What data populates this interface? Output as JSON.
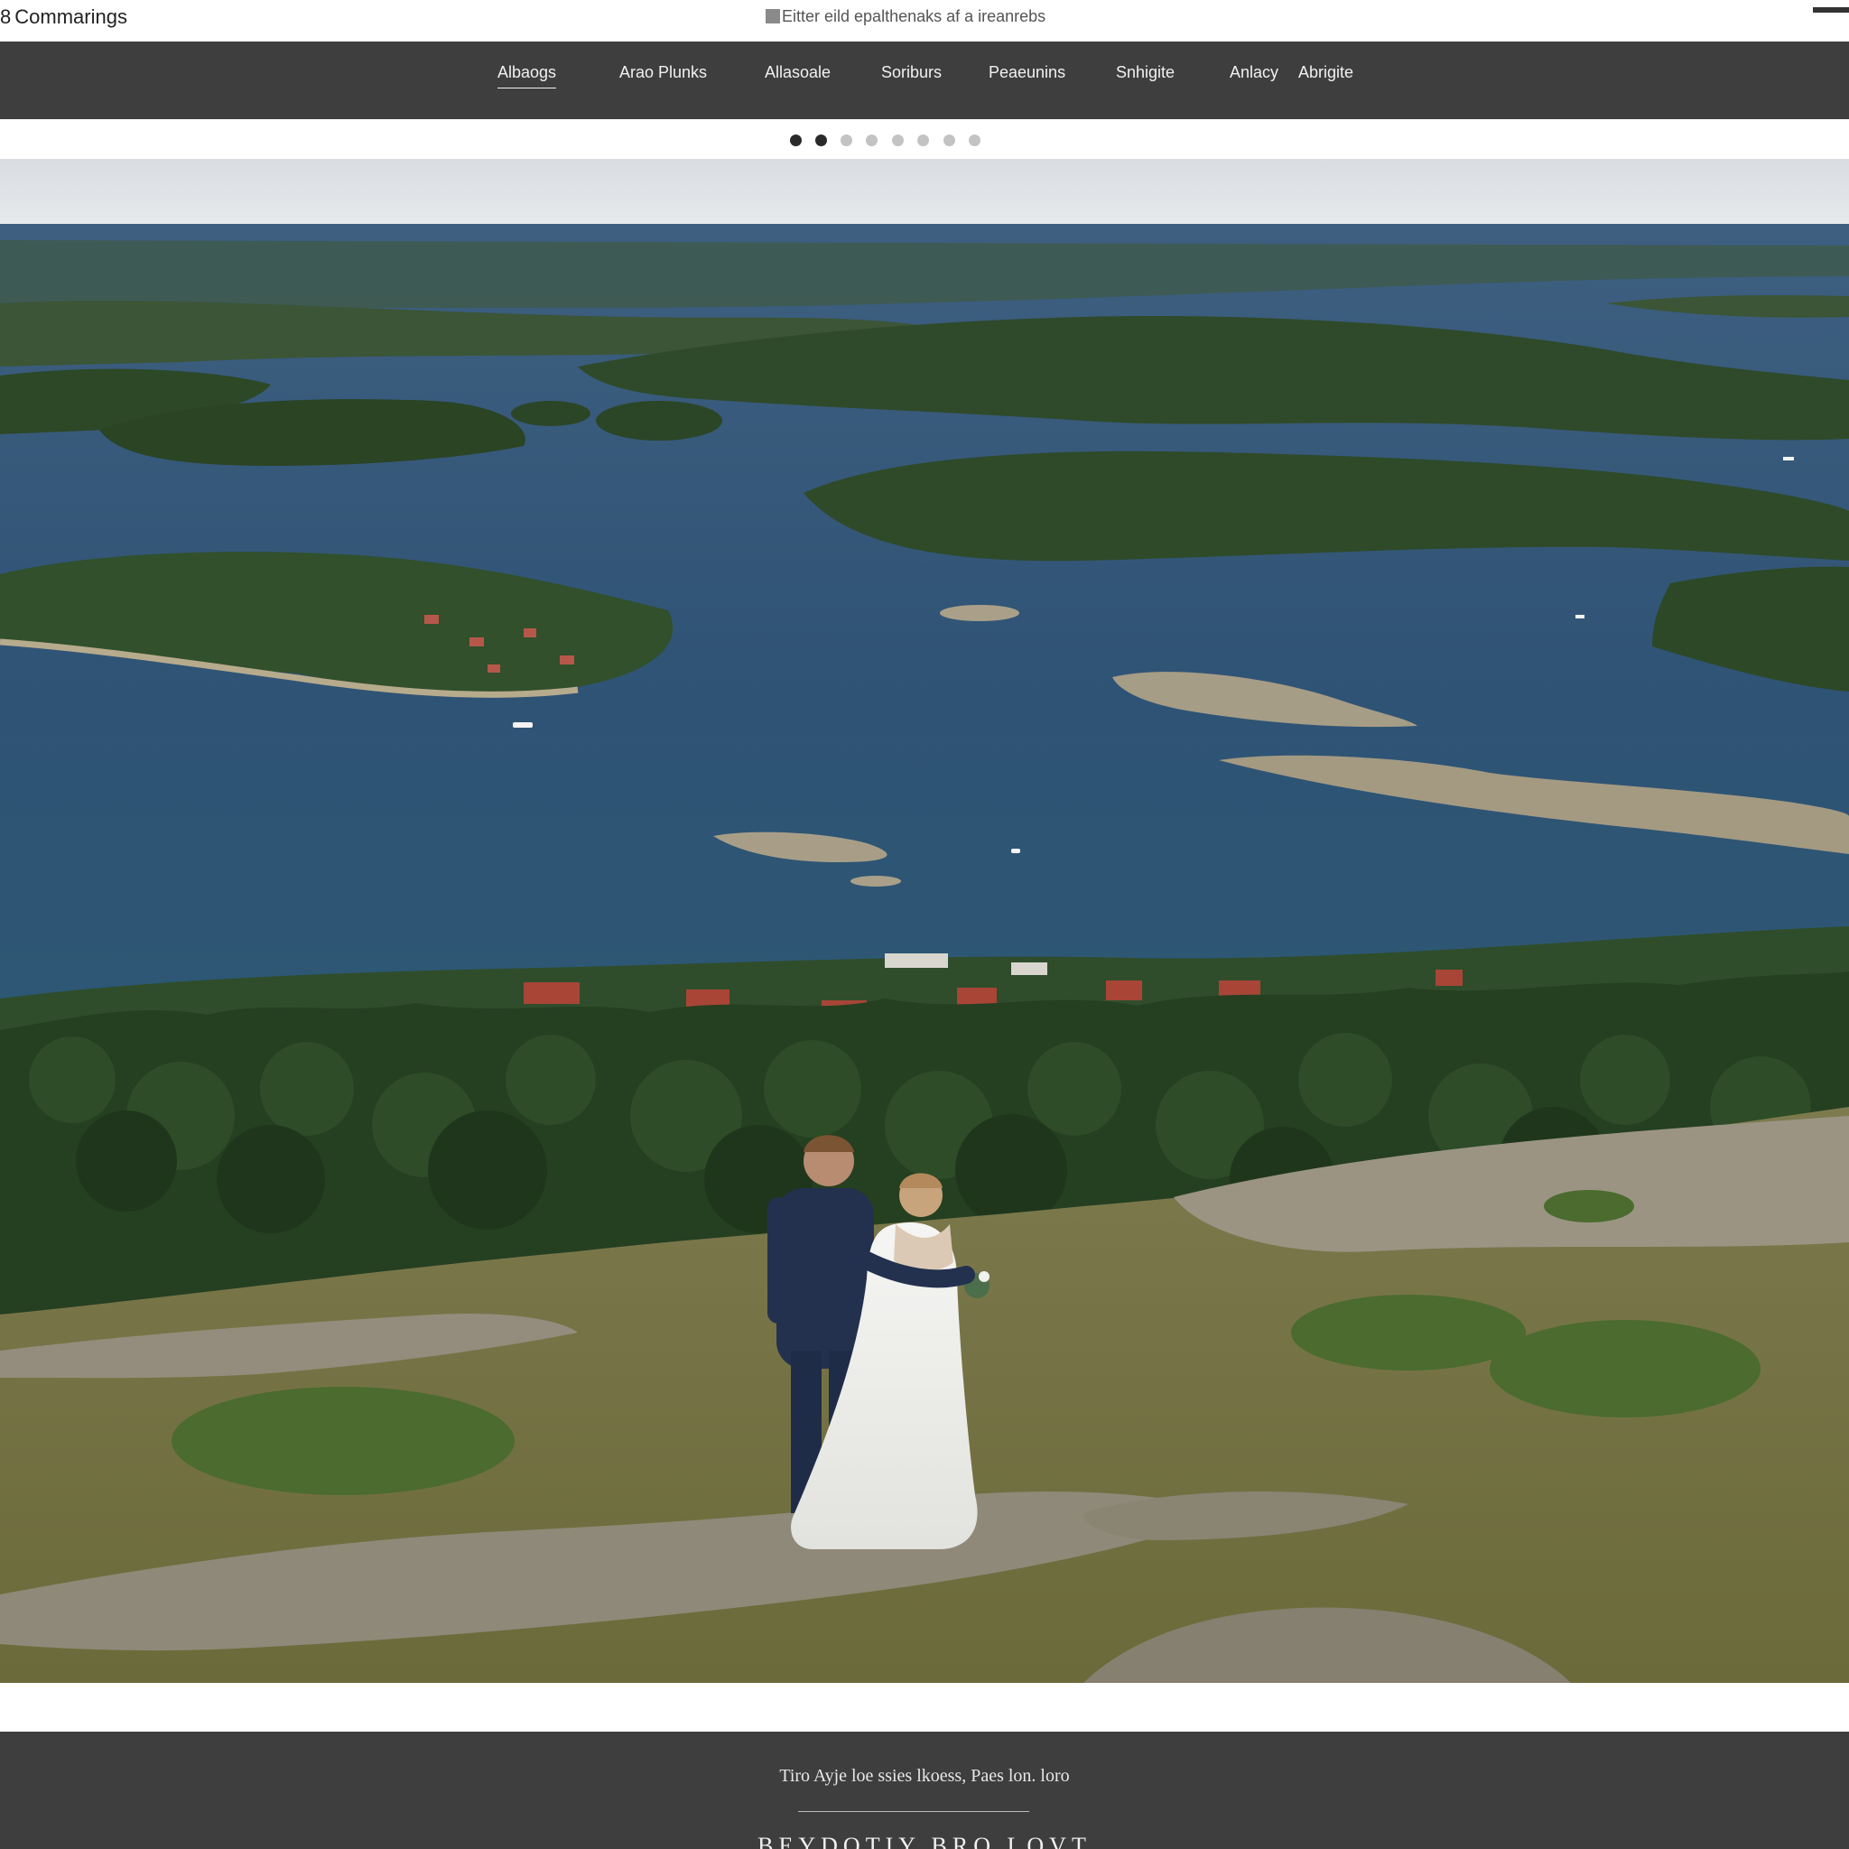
{
  "header": {
    "brand": "Commarings",
    "brand_mark": "8",
    "tagline": "Eitter eild epalthenaks af a ireanrebs"
  },
  "nav": {
    "items": [
      {
        "label": "Albaogs",
        "active": true
      },
      {
        "label": "Arao Plunks",
        "active": false
      },
      {
        "label": "Allasoale",
        "active": false
      },
      {
        "label": "Soriburs",
        "active": false
      },
      {
        "label": "Peaeunins",
        "active": false
      },
      {
        "label": "Snhigite",
        "active": false
      },
      {
        "label": "Anlacy",
        "active": false
      },
      {
        "label": "Abrigite",
        "active": false
      }
    ]
  },
  "carousel": {
    "slide_count": 8,
    "active_indices": [
      0,
      1
    ]
  },
  "hero": {
    "image_description_icon": "archipelago-wedding-photo"
  },
  "footer": {
    "caption": "Tiro Ayje loe ssies lkoess, Paes lon. loro",
    "title": "BEYDOTIY BRO LOVT"
  },
  "colors": {
    "nav_bg": "#3e3e3e",
    "footer_bg": "#3e3e3e",
    "dot_active": "#2a2a2a",
    "dot_inactive": "#c3c3c3",
    "water": "#2f5375",
    "forest": "#2f4a2a"
  }
}
